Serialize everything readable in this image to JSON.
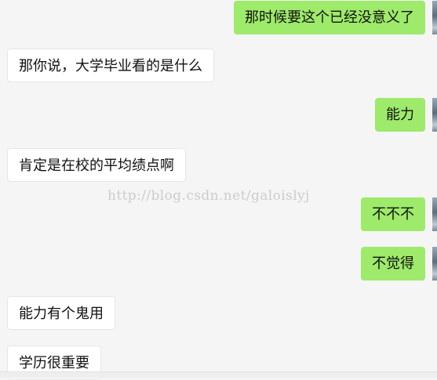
{
  "messages": [
    {
      "side": "right",
      "text": "那时候要这个已经没意义了"
    },
    {
      "side": "left",
      "text": "那你说，大学毕业看的是什么"
    },
    {
      "side": "right",
      "text": "能力"
    },
    {
      "side": "left",
      "text": "肯定是在校的平均绩点啊"
    },
    {
      "side": "right",
      "text": "不不不"
    },
    {
      "side": "right",
      "text": "不觉得"
    },
    {
      "side": "left",
      "text": "能力有个鬼用"
    },
    {
      "side": "left",
      "text": "学历很重要"
    }
  ],
  "watermark": "http://blog.csdn.net/galoislyj",
  "colors": {
    "background": "#f5f5f5",
    "sent_bubble": "#9eea6a",
    "received_bubble": "#ffffff"
  }
}
